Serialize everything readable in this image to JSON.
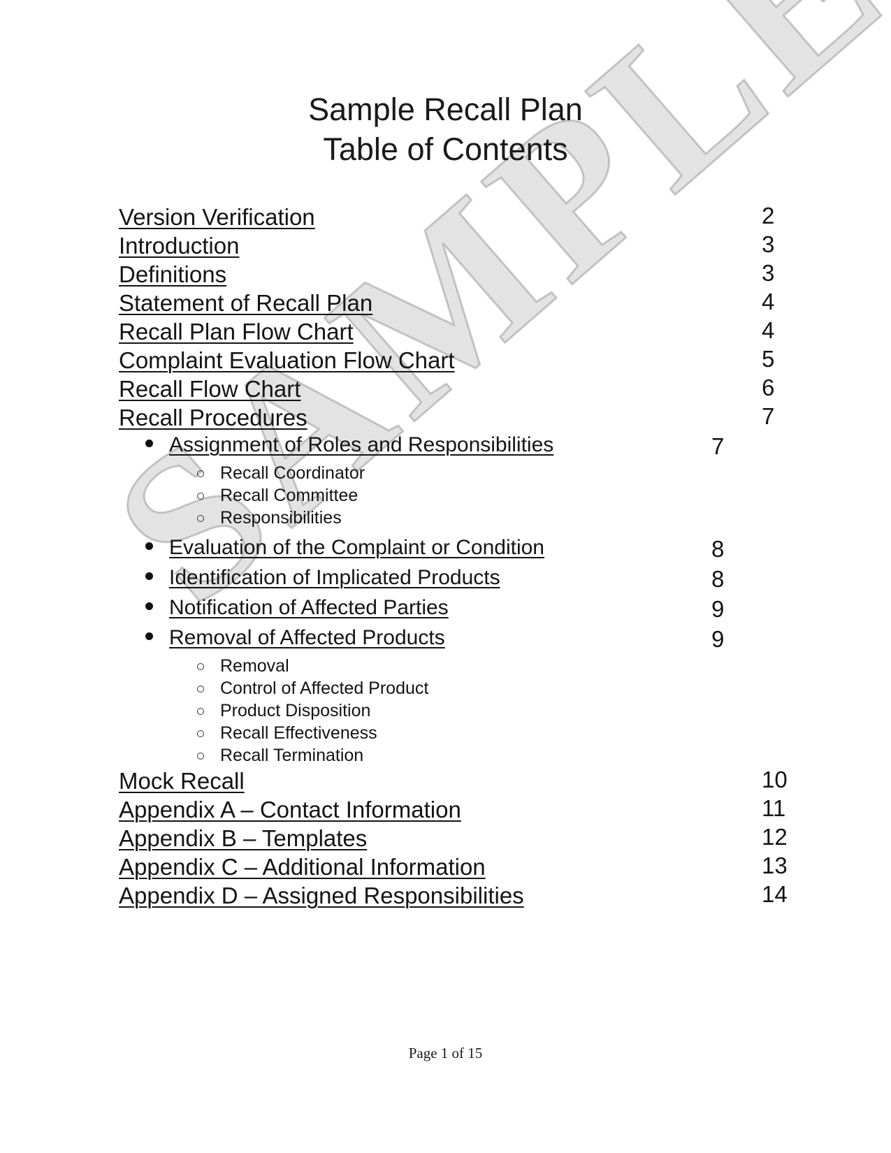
{
  "document": {
    "title_line1": "Sample Recall Plan",
    "title_line2": "Table of Contents",
    "watermark": "SAMPLE",
    "footer": "Page 1 of 15"
  },
  "toc": {
    "entries": [
      {
        "level": 1,
        "label": "Version Verification",
        "page": "2",
        "underline": true
      },
      {
        "level": 1,
        "label": "Introduction",
        "page": "3",
        "underline": true
      },
      {
        "level": 1,
        "label": "Definitions",
        "page": "3",
        "underline": true
      },
      {
        "level": 1,
        "label": "Statement of Recall Plan",
        "page": "4",
        "underline": true
      },
      {
        "level": 1,
        "label": "Recall Plan Flow Chart",
        "page": "4",
        "underline": true
      },
      {
        "level": 1,
        "label": "Complaint Evaluation Flow Chart",
        "page": "5",
        "underline": true
      },
      {
        "level": 1,
        "label": "Recall Flow Chart",
        "page": "6",
        "underline": true
      },
      {
        "level": 1,
        "label": "Recall Procedures",
        "page": "7",
        "underline": true
      },
      {
        "level": 2,
        "label": "Assignment of Roles and Responsibilities",
        "page": "7",
        "underline": true
      },
      {
        "level": 3,
        "label": "Recall Coordinator",
        "page": "",
        "underline": false
      },
      {
        "level": 3,
        "label": "Recall Committee",
        "page": "",
        "underline": false
      },
      {
        "level": 3,
        "label": "Responsibilities",
        "page": "",
        "underline": false
      },
      {
        "level": 2,
        "label": "Evaluation of the Complaint or Condition",
        "page": "8",
        "underline": true
      },
      {
        "level": 2,
        "label": "Identification of Implicated Products",
        "page": "8",
        "underline": true
      },
      {
        "level": 2,
        "label": "Notification of Affected Parties",
        "page": "9",
        "underline": true
      },
      {
        "level": 2,
        "label": "Removal of Affected Products",
        "page": "9",
        "underline": true
      },
      {
        "level": 3,
        "label": "Removal",
        "page": "",
        "underline": false
      },
      {
        "level": 3,
        "label": "Control of Affected Product",
        "page": "",
        "underline": false
      },
      {
        "level": 3,
        "label": "Product Disposition",
        "page": "",
        "underline": false
      },
      {
        "level": 3,
        "label": "Recall Effectiveness",
        "page": "",
        "underline": false
      },
      {
        "level": 3,
        "label": "Recall Termination",
        "page": "",
        "underline": false
      },
      {
        "level": 1,
        "label": "Mock Recall",
        "page": "10",
        "underline": true
      },
      {
        "level": 1,
        "label": "Appendix A – Contact Information",
        "page": "11",
        "underline": true
      },
      {
        "level": 1,
        "label": "Appendix B – Templates",
        "page": "12",
        "underline": true
      },
      {
        "level": 1,
        "label": "Appendix C – Additional Information",
        "page": "13",
        "underline": true
      },
      {
        "level": 1,
        "label": "Appendix D – Assigned Responsibilities",
        "page": "14",
        "underline": true
      }
    ]
  }
}
